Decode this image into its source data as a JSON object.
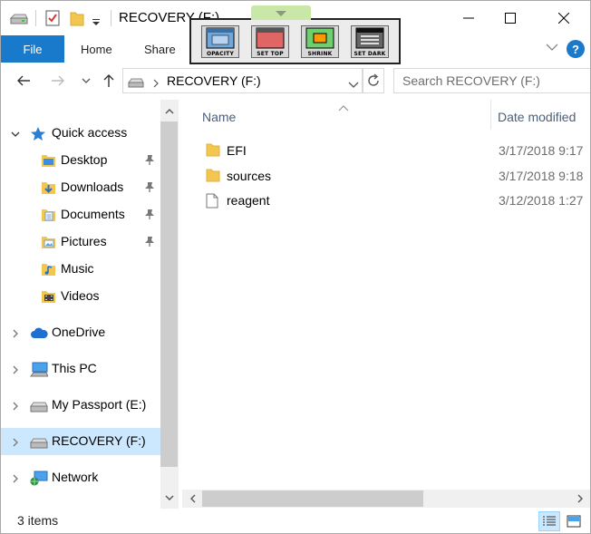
{
  "window": {
    "title": "RECOVERY (F:)",
    "controls": {
      "minimize": "—",
      "maximize": "☐",
      "close": "✕"
    }
  },
  "overlay_toolbar": {
    "tab_label": "",
    "buttons": [
      {
        "label": "OPACITY",
        "icon": "opacity-icon",
        "color": "#6fa8dc"
      },
      {
        "label": "SET TOP",
        "icon": "set-top-icon",
        "color": "#e06666"
      },
      {
        "label": "SHRINK",
        "icon": "shrink-icon",
        "color": "#ff9900"
      },
      {
        "label": "SET DARK",
        "icon": "set-dark-icon",
        "color": "#333333"
      }
    ]
  },
  "ribbon": {
    "tabs": [
      "File",
      "Home",
      "Share"
    ],
    "help": "?"
  },
  "address": {
    "path": "RECOVERY (F:)",
    "search_placeholder": "Search RECOVERY (F:)"
  },
  "nav": {
    "quick_access": "Quick access",
    "quick_items": [
      {
        "label": "Desktop",
        "pinned": true
      },
      {
        "label": "Downloads",
        "pinned": true
      },
      {
        "label": "Documents",
        "pinned": true
      },
      {
        "label": "Pictures",
        "pinned": true
      },
      {
        "label": "Music",
        "pinned": false
      },
      {
        "label": "Videos",
        "pinned": false
      }
    ],
    "locations": [
      {
        "label": "OneDrive"
      },
      {
        "label": "This PC"
      },
      {
        "label": "My Passport (E:)"
      },
      {
        "label": "RECOVERY (F:)",
        "selected": true
      },
      {
        "label": "Network"
      }
    ]
  },
  "files": {
    "columns": {
      "name": "Name",
      "date": "Date modified"
    },
    "rows": [
      {
        "name": "EFI",
        "type": "folder",
        "date": "3/17/2018 9:17"
      },
      {
        "name": "sources",
        "type": "folder",
        "date": "3/17/2018 9:18"
      },
      {
        "name": "reagent",
        "type": "file",
        "date": "3/12/2018 1:27"
      }
    ]
  },
  "status": {
    "items": "3 items"
  },
  "colors": {
    "accent": "#1979ca",
    "selected": "#cce8ff",
    "folder": "#f3c74f",
    "header_text": "#4c607a"
  }
}
